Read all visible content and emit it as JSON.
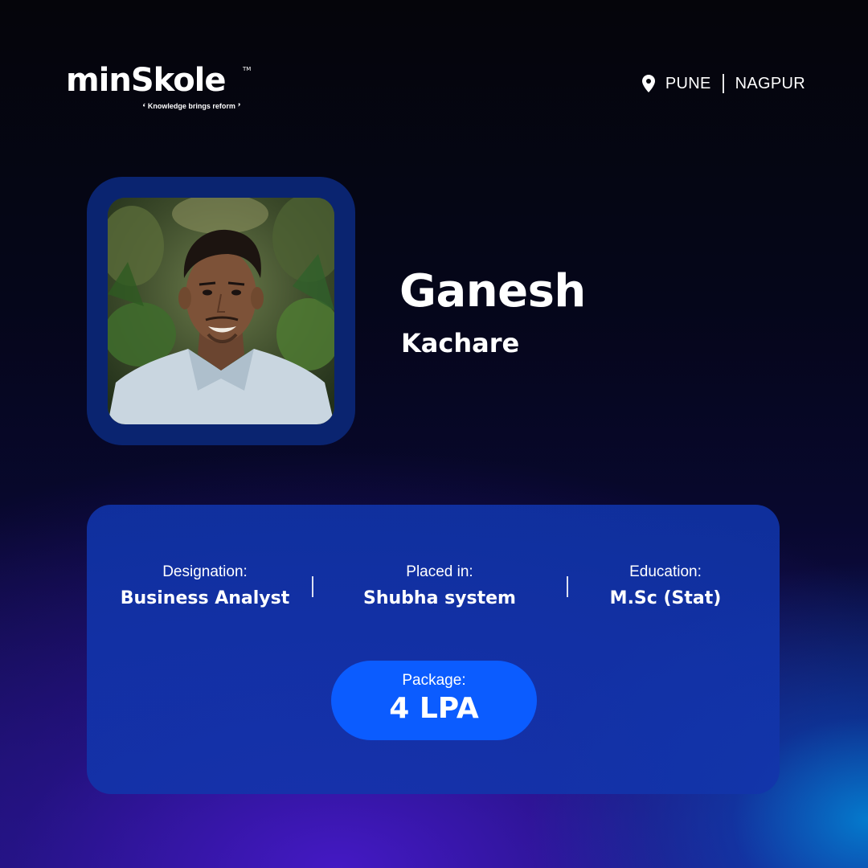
{
  "brand": {
    "name": "minSkole",
    "trademark": "TM",
    "tagline": "Knowledge brings reform"
  },
  "locations": [
    "PUNE",
    "NAGPUR"
  ],
  "profile": {
    "first_name": "Ganesh",
    "last_name": "Kachare"
  },
  "details": {
    "designation": {
      "label": "Designation:",
      "value": "Business Analyst"
    },
    "placed_in": {
      "label": "Placed in:",
      "value": "Shubha system"
    },
    "education": {
      "label": "Education:",
      "value": "M.Sc (Stat)"
    },
    "package": {
      "label": "Package:",
      "value": "4 LPA"
    }
  },
  "icons": {
    "location": "map-pin-icon"
  },
  "colors": {
    "background_top": "#05050a",
    "background_bottom": "#1a1270",
    "photo_frame": "#0a2470",
    "card": "#1236aa",
    "package_pill": "#0b5cff",
    "text": "#ffffff"
  }
}
